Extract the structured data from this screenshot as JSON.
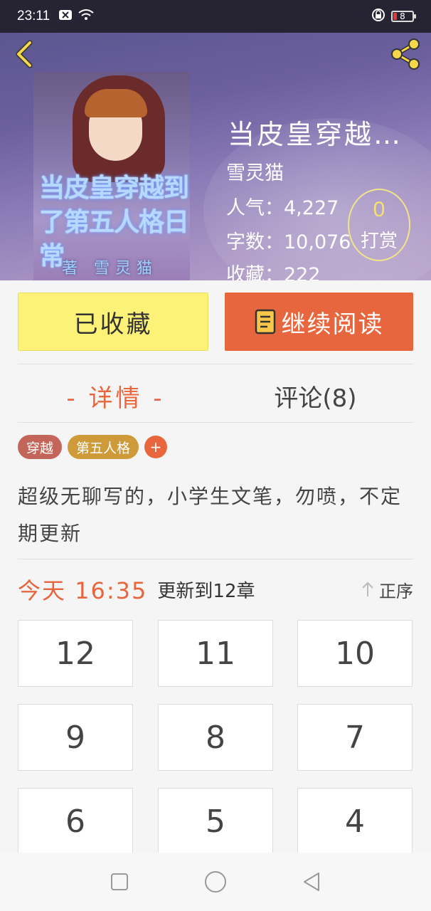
{
  "status_bar": {
    "time": "23:11",
    "battery_level": "8"
  },
  "book": {
    "title": "当皮皇穿越…",
    "author": "雪灵猫",
    "popularity_label": "人气：",
    "popularity_value": "4,227",
    "word_count_label": "字数：",
    "word_count_value": "10,076",
    "favorites_label": "收藏：",
    "favorites_value": "222",
    "cover_title": "当皮皇穿越到了第五人格日常",
    "cover_author": "著 雪灵猫"
  },
  "tip": {
    "count": "0",
    "label": "打赏"
  },
  "actions": {
    "collected_label": "已收藏",
    "continue_label": "继续阅读"
  },
  "tabs": {
    "details": "- 详情 -",
    "comments": "评论(8)"
  },
  "tags": [
    "穿越",
    "第五人格"
  ],
  "tag_add": "+",
  "description": "超级无聊写的，小学生文笔，勿喷，不定期更新",
  "update": {
    "time": "今天 16:35",
    "text": "更新到12章",
    "sort_label": "正序"
  },
  "chapters": [
    "12",
    "11",
    "10",
    "9",
    "8",
    "7",
    "6",
    "5",
    "4"
  ],
  "colors": {
    "accent": "#e8663d",
    "collected_bg": "#fcf278",
    "tip_gold": "#f6e26a"
  },
  "icons": {
    "back": "chevron-left-icon",
    "share": "share-icon",
    "book": "book-icon",
    "sort": "arrow-up-icon",
    "nav_recent": "square-icon",
    "nav_home": "circle-icon",
    "nav_back": "triangle-back-icon"
  }
}
